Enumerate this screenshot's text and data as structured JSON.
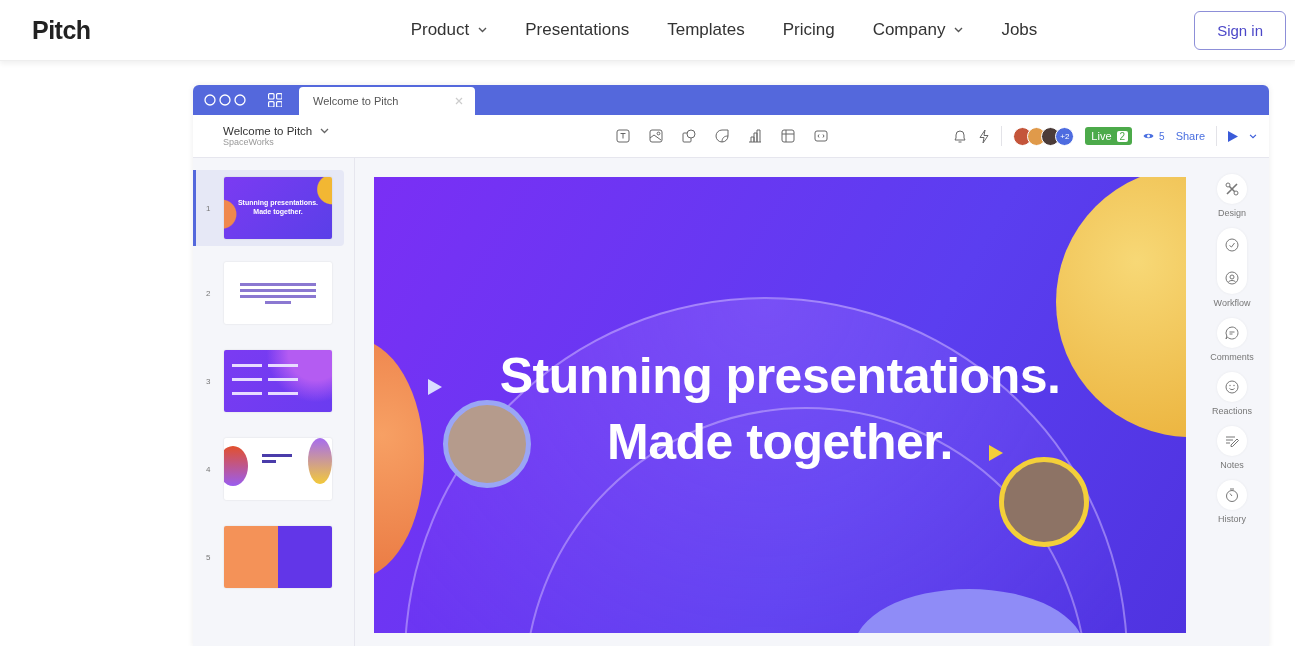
{
  "nav": {
    "logo": "Pitch",
    "links": [
      {
        "label": "Product",
        "dropdown": true
      },
      {
        "label": "Presentations",
        "dropdown": false
      },
      {
        "label": "Templates",
        "dropdown": false
      },
      {
        "label": "Pricing",
        "dropdown": false
      },
      {
        "label": "Company",
        "dropdown": true
      },
      {
        "label": "Jobs",
        "dropdown": false
      }
    ],
    "sign_in": "Sign in"
  },
  "app": {
    "tab_title": "Welcome to Pitch",
    "doc_title": "Welcome to Pitch",
    "workspace": "SpaceWorks",
    "avatar_extra": "+2",
    "live": "Live",
    "live_count": "2",
    "viewers": "5",
    "share": "Share"
  },
  "slides": [
    {
      "number": "1",
      "selected": true,
      "kind": "title",
      "title": "Stunning presentations. Made together."
    },
    {
      "number": "2",
      "selected": false,
      "kind": "text"
    },
    {
      "number": "3",
      "selected": false,
      "kind": "list"
    },
    {
      "number": "4",
      "selected": false,
      "kind": "shapes"
    },
    {
      "number": "5",
      "selected": false,
      "kind": "split"
    }
  ],
  "headline": [
    "Stunning presentations.",
    "Made together."
  ],
  "tools": [
    {
      "label": "Design",
      "kind": "single"
    },
    {
      "label": "Workflow",
      "kind": "double"
    },
    {
      "label": "Comments",
      "kind": "single"
    },
    {
      "label": "Reactions",
      "kind": "single"
    },
    {
      "label": "Notes",
      "kind": "single"
    },
    {
      "label": "History",
      "kind": "single"
    }
  ]
}
